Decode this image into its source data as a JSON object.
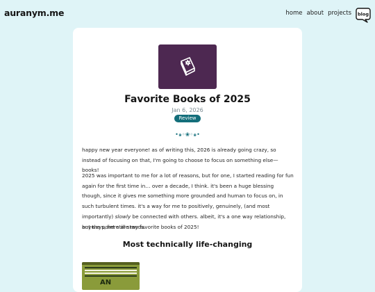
{
  "site": {
    "logo": "auranym.me",
    "nav": [
      "home",
      "about",
      "projects"
    ],
    "blog_icon_label": "blog"
  },
  "post": {
    "title": "Favorite Books of 2025",
    "date": "Jan 6, 2026",
    "tag": "Review",
    "ornament": "•๑◦❀◦๑•",
    "paragraph1": "happy new year everyone! as of writing this, 2026 is already going crazy, so instead of focusing on that, I'm going to choose to focus on something else—books!",
    "paragraph2_before": "2025 was important to me for a lot of reasons, but for one, I started reading for fun again for the first time in… over a decade, I think. it's been a huge blessing though, since it gives me something more grounded and human to focus on, in such turbulent times. it's a way for me to positively, genuinely, (and most importantly) ",
    "paragraph2_emph": "slowly",
    "paragraph2_after": " be connected with others. albeit, it's a one way relationship, but the point still stands.",
    "paragraph3": "anyways, here are my favorite books of 2025!",
    "section_heading": "Most technically life-changing",
    "first_book_cover_text": "AN"
  },
  "colors": {
    "page_bg": "#dff4f7",
    "card_bg": "#ffffff",
    "hero_bg": "#4d2851",
    "accent": "#136e7a"
  },
  "icons": {
    "hero": "book-icon",
    "blog": "speech-bubble-icon"
  }
}
